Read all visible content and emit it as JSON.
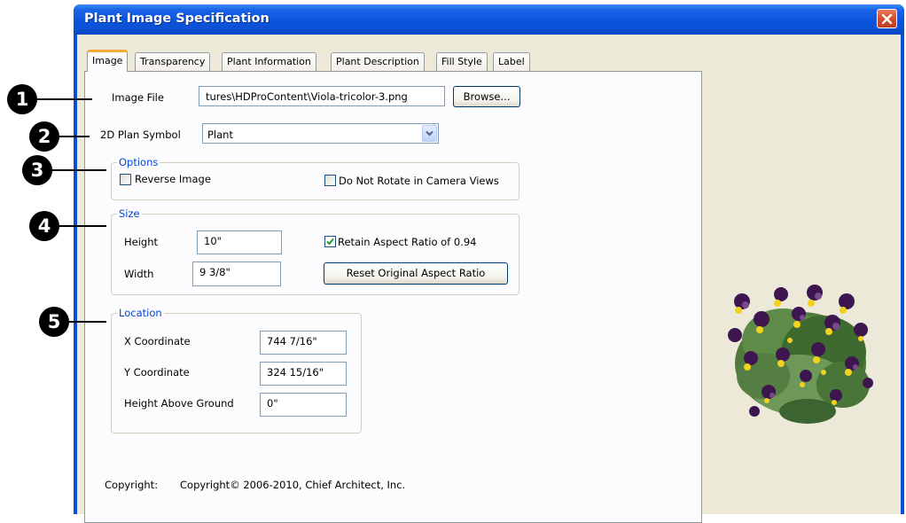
{
  "window": {
    "title": "Plant Image Specification"
  },
  "tabs": [
    {
      "label": "Image"
    },
    {
      "label": "Transparency"
    },
    {
      "label": "Plant Information"
    },
    {
      "label": "Plant Description"
    },
    {
      "label": "Fill Style"
    },
    {
      "label": "Label"
    }
  ],
  "active_tab": "Image",
  "image_file": {
    "label": "Image File",
    "value": "tures\\HDProContent\\Viola-tricolor-3.png",
    "browse_label": "Browse..."
  },
  "plan_symbol": {
    "label": "2D Plan Symbol",
    "selected": "Plant"
  },
  "options": {
    "title": "Options",
    "reverse_image": {
      "label": "Reverse Image",
      "checked": false
    },
    "do_not_rotate": {
      "label": "Do Not Rotate in Camera Views",
      "checked": false
    }
  },
  "size": {
    "title": "Size",
    "height_label": "Height",
    "height_value": "10\"",
    "width_label": "Width",
    "width_value": "9 3/8\"",
    "retain_aspect": {
      "label": "Retain Aspect Ratio of 0.94",
      "checked": true
    },
    "reset_button": "Reset Original Aspect Ratio"
  },
  "location": {
    "title": "Location",
    "x_label": "X Coordinate",
    "x_value": "744 7/16\"",
    "y_label": "Y Coordinate",
    "y_value": "324 15/16\"",
    "h_label": "Height Above Ground",
    "h_value": "0\""
  },
  "copyright": {
    "label": "Copyright:",
    "value": "Copyright© 2006-2010, Chief Architect, Inc."
  },
  "callouts": [
    "1",
    "2",
    "3",
    "4",
    "5"
  ],
  "colors": {
    "title_bar": "#0a55de",
    "dialog_bg": "#ece9d8",
    "group_title": "#0046d5",
    "active_tab_accent": "#f7a935",
    "close_button": "#d0482a"
  },
  "icons": {
    "close": "close-icon",
    "dropdown": "chevron-down-icon",
    "check": "checkmark-icon",
    "preview": "plant-preview-image"
  }
}
